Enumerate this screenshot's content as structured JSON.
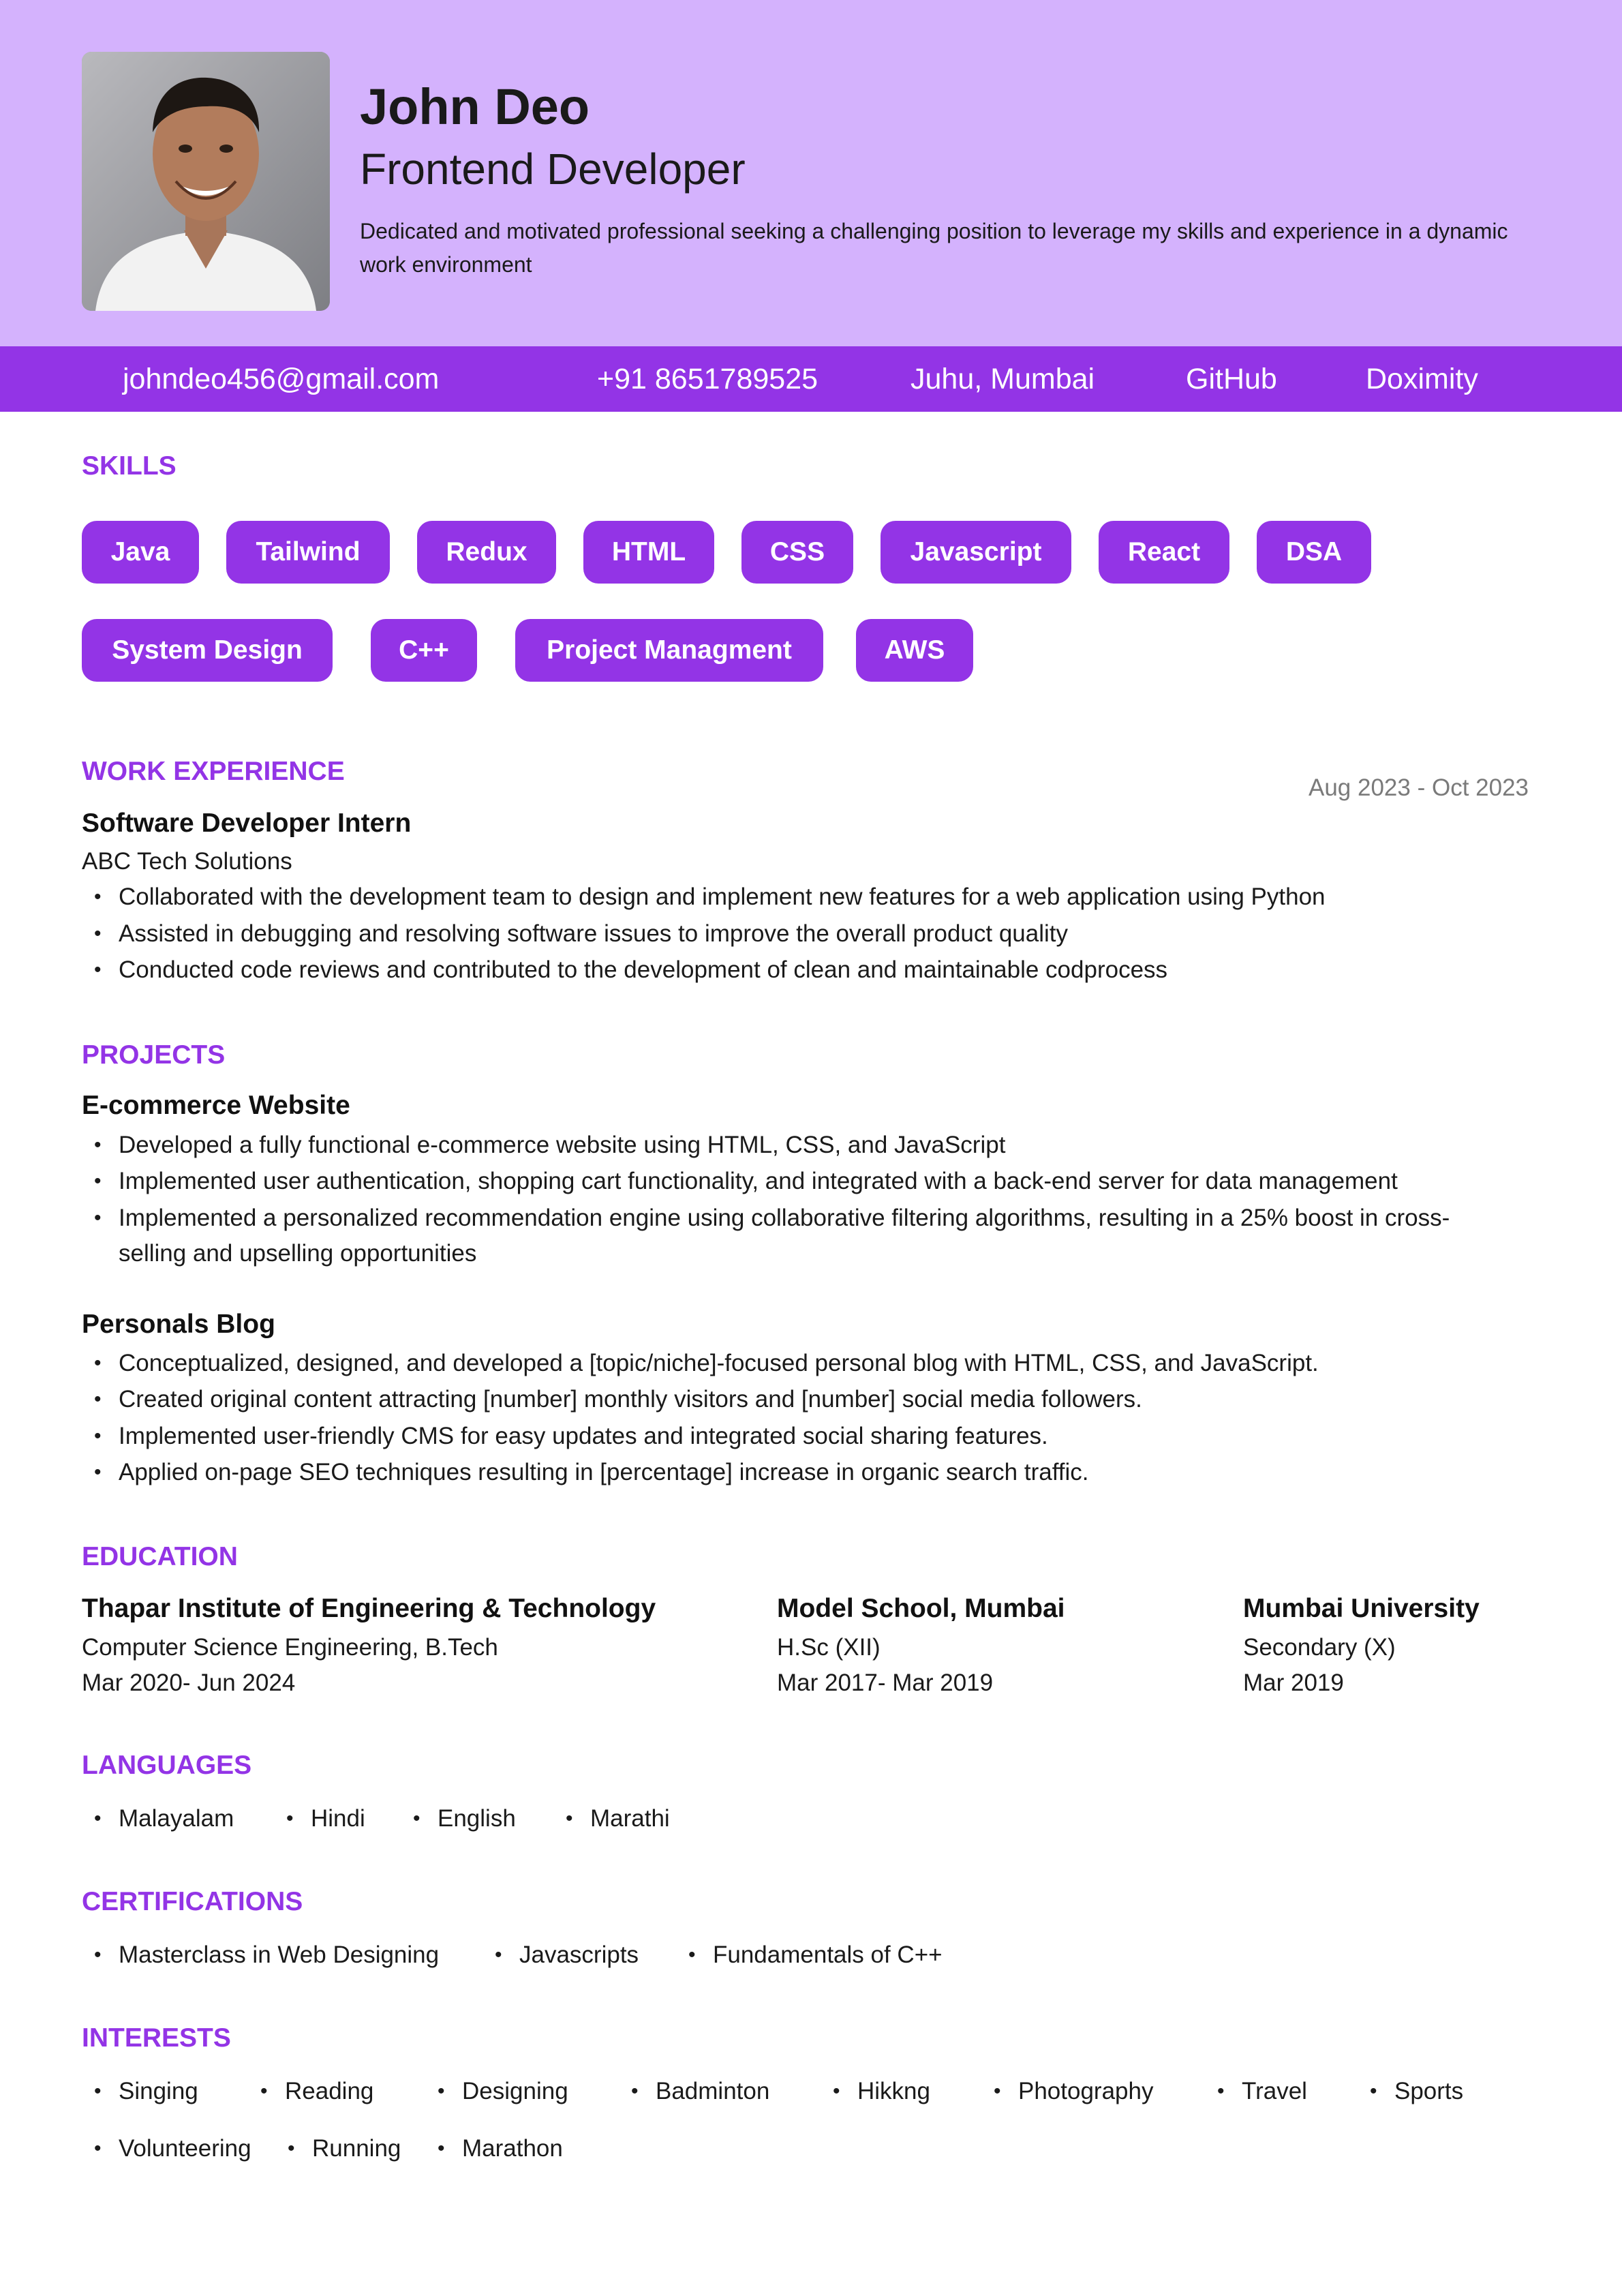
{
  "header": {
    "name": "John Deo",
    "role": "Frontend Developer",
    "summary": "Dedicated and motivated professional seeking a challenging position to leverage my skills and experience in a dynamic work environment",
    "bg_color": "#d4b2fd"
  },
  "contact": {
    "email": "johndeo456@gmail.com",
    "phone": "+91 8651789525",
    "location": "Juhu, Mumbai",
    "github": "GitHub",
    "doximity": "Doximity",
    "bg_color": "#9334e6"
  },
  "skills": {
    "title": "SKILLS",
    "items": [
      "Java",
      "Tailwind",
      "Redux",
      "HTML",
      "CSS",
      "Javascript",
      "React",
      "DSA",
      "System Design",
      "C++",
      "Project Managment",
      "AWS"
    ],
    "chip_color": "#9334e6"
  },
  "experience": {
    "title": "WORK EXPERIENCE",
    "role": "Software Developer Intern",
    "company": "ABC Tech Solutions",
    "dates": "Aug 2023 - Oct 2023",
    "bullets": [
      "Collaborated with the development team to design and implement new features for a web application using Python",
      "Assisted in debugging and resolving software issues to improve the overall product quality",
      "Conducted code reviews and contributed to the development of clean and maintainable codprocess"
    ]
  },
  "projects": {
    "title": "PROJECTS",
    "items": [
      {
        "name": "E-commerce Website",
        "bullets": [
          "Developed a fully functional e-commerce website using HTML, CSS, and JavaScript",
          "Implemented user authentication, shopping cart functionality, and integrated with a back-end server for data management",
          "Implemented a personalized recommendation engine using collaborative filtering algorithms, resulting in a 25% boost in cross-selling and upselling opportunities"
        ]
      },
      {
        "name": "Personals Blog",
        "bullets": [
          "Conceptualized, designed, and developed a [topic/niche]-focused personal blog with HTML, CSS, and JavaScript.",
          "Created original content attracting [number] monthly visitors and [number] social media followers.",
          "Implemented user-friendly CMS for easy updates and integrated social sharing features.",
          "Applied on-page SEO techniques resulting in [percentage] increase in organic search traffic."
        ]
      }
    ]
  },
  "education": {
    "title": "EDUCATION",
    "items": [
      {
        "school": "Thapar Institute of Engineering & Technology",
        "degree": "Computer Science Engineering, B.Tech",
        "dates": "Mar 2020- Jun 2024"
      },
      {
        "school": "Model School, Mumbai",
        "degree": "H.Sc (XII)",
        "dates": "Mar 2017- Mar 2019"
      },
      {
        "school": "Mumbai University",
        "degree": "Secondary (X)",
        "dates": "Mar 2019"
      }
    ]
  },
  "languages": {
    "title": "LANGUAGES",
    "items": [
      "Malayalam",
      "Hindi",
      "English",
      "Marathi"
    ]
  },
  "certifications": {
    "title": "CERTIFICATIONS",
    "items": [
      "Masterclass in Web Designing",
      "Javascripts",
      "Fundamentals of C++"
    ]
  },
  "interests": {
    "title": "INTERESTS",
    "items": [
      "Singing",
      "Reading",
      "Designing",
      "Badminton",
      "Hikkng",
      "Photography",
      "Travel",
      "Sports",
      "Volunteering",
      "Running",
      "Marathon"
    ]
  }
}
